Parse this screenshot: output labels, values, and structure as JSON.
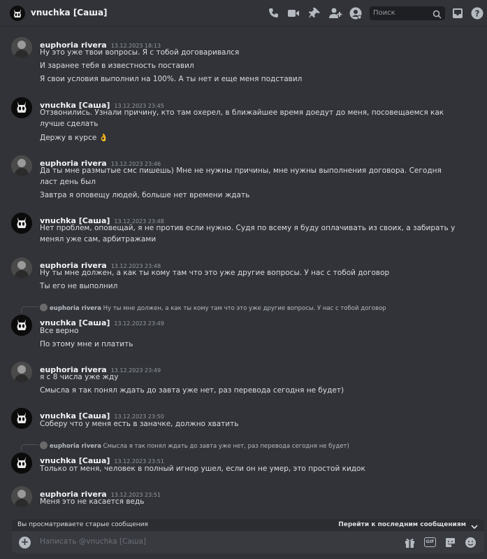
{
  "header": {
    "title": "vnuchka [Саша]",
    "search_placeholder": "Поиск"
  },
  "messages": [
    {
      "author": "euphoria rivera",
      "time": "13.12.2023 18:13",
      "lines": [
        "Ну это уже твои вопросы. Я с тобой договаривался",
        "И заранее тебя в известность поставил",
        "Я свои условия выполнил на 100%. А ты нет и еще меня подставил"
      ]
    },
    {
      "author": "vnuchka [Саша]",
      "time": "13.12.2023 23:45",
      "lines": [
        "Отзвонились. Узнали причину, кто там охерел, в ближайшее время доедут до меня, посовещаемся как лучше сделать",
        "Держу в курсе 👌"
      ]
    },
    {
      "author": "euphoria rivera",
      "time": "13.12.2023 23:46",
      "lines": [
        "Да ты мне размытые смс пишешь) Мне не нужны причины, мне нужны выполнения договора. Сегодня ласт день был",
        "Завтра я оповещу людей, больше нет времени ждать"
      ]
    },
    {
      "author": "vnuchka [Саша]",
      "time": "13.12.2023 23:48",
      "lines": [
        "Нет проблем, оповещай, я не против если нужно. Судя по всему я буду оплачивать из своих, а забирать у менял уже сам, арбитражами"
      ]
    },
    {
      "author": "euphoria rivera",
      "time": "13.12.2023 23:48",
      "lines": [
        "Ну ты мне должен, а как ты кому там  что это уже другие вопросы. У нас с тобой договор",
        "Ты его не выполнил"
      ]
    },
    {
      "reply_to": "euphoria rivera",
      "reply_text": "Ну ты мне должен, а как ты кому там что это уже другие вопросы. У нас с тобой договор",
      "author": "vnuchka [Саша]",
      "time": "13.12.2023 23:49",
      "lines": [
        "Все верно",
        "По этому мне и платить"
      ]
    },
    {
      "author": "euphoria rivera",
      "time": "13.12.2023 23:49",
      "lines": [
        "я с 8 числа уже жду",
        "Смысла я так понял ждать до завта уже нет, раз перевода сегодня не будет)"
      ]
    },
    {
      "author": "vnuchka [Саша]",
      "time": "13.12.2023 23:50",
      "lines": [
        "Соберу что у меня есть в заначке, должно хватить"
      ]
    },
    {
      "reply_to": "euphoria rivera",
      "reply_text": "Смысла я так понял ждать до завта уже нет, раз перевода сегодня не будет)",
      "author": "vnuchka [Саша]",
      "time": "13.12.2023 23:51",
      "lines": [
        "Только от меня, человек в полный игнор ушел, если он не умер, это простой кидок"
      ]
    },
    {
      "author": "euphoria rivera",
      "time": "13.12.2023 23:51",
      "lines": [
        "Меня это не касается ведь"
      ]
    }
  ],
  "old_messages_bar": {
    "notice": "Вы просматриваете старые сообщения",
    "jump_label": "Перейти к последним сообщениям"
  },
  "composer": {
    "placeholder": "Написать @vnuchka [Саша]",
    "gif_label": "GIF"
  }
}
